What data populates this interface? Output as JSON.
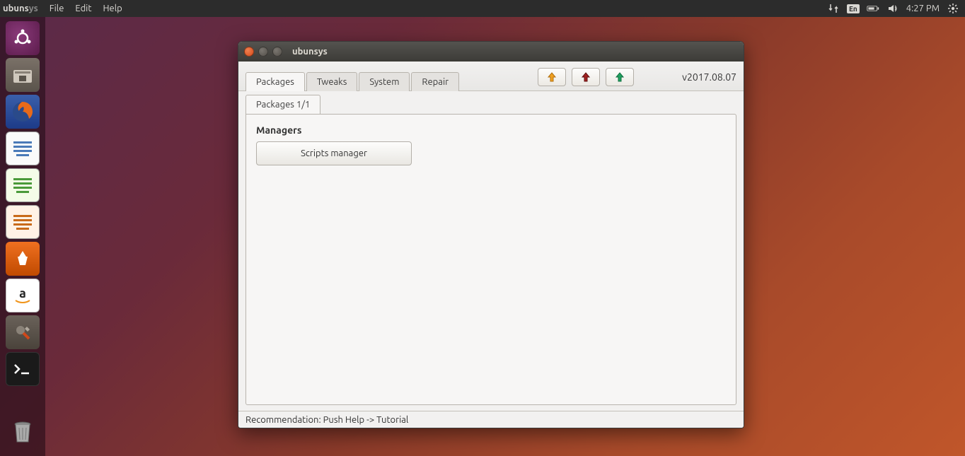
{
  "menubar": {
    "app_prefix": "ubuns",
    "app_suffix": "ys",
    "items": [
      "File",
      "Edit",
      "Help"
    ],
    "language": "En",
    "time": "4:27 PM"
  },
  "window": {
    "title": "ubunsys",
    "tabs": [
      "Packages",
      "Tweaks",
      "System",
      "Repair"
    ],
    "version": "v2017.08.07",
    "sub_tab": "Packages 1/1",
    "section_title": "Managers",
    "scripts_btn": "Scripts manager",
    "status": "Recommendation: Push Help -> Tutorial"
  }
}
